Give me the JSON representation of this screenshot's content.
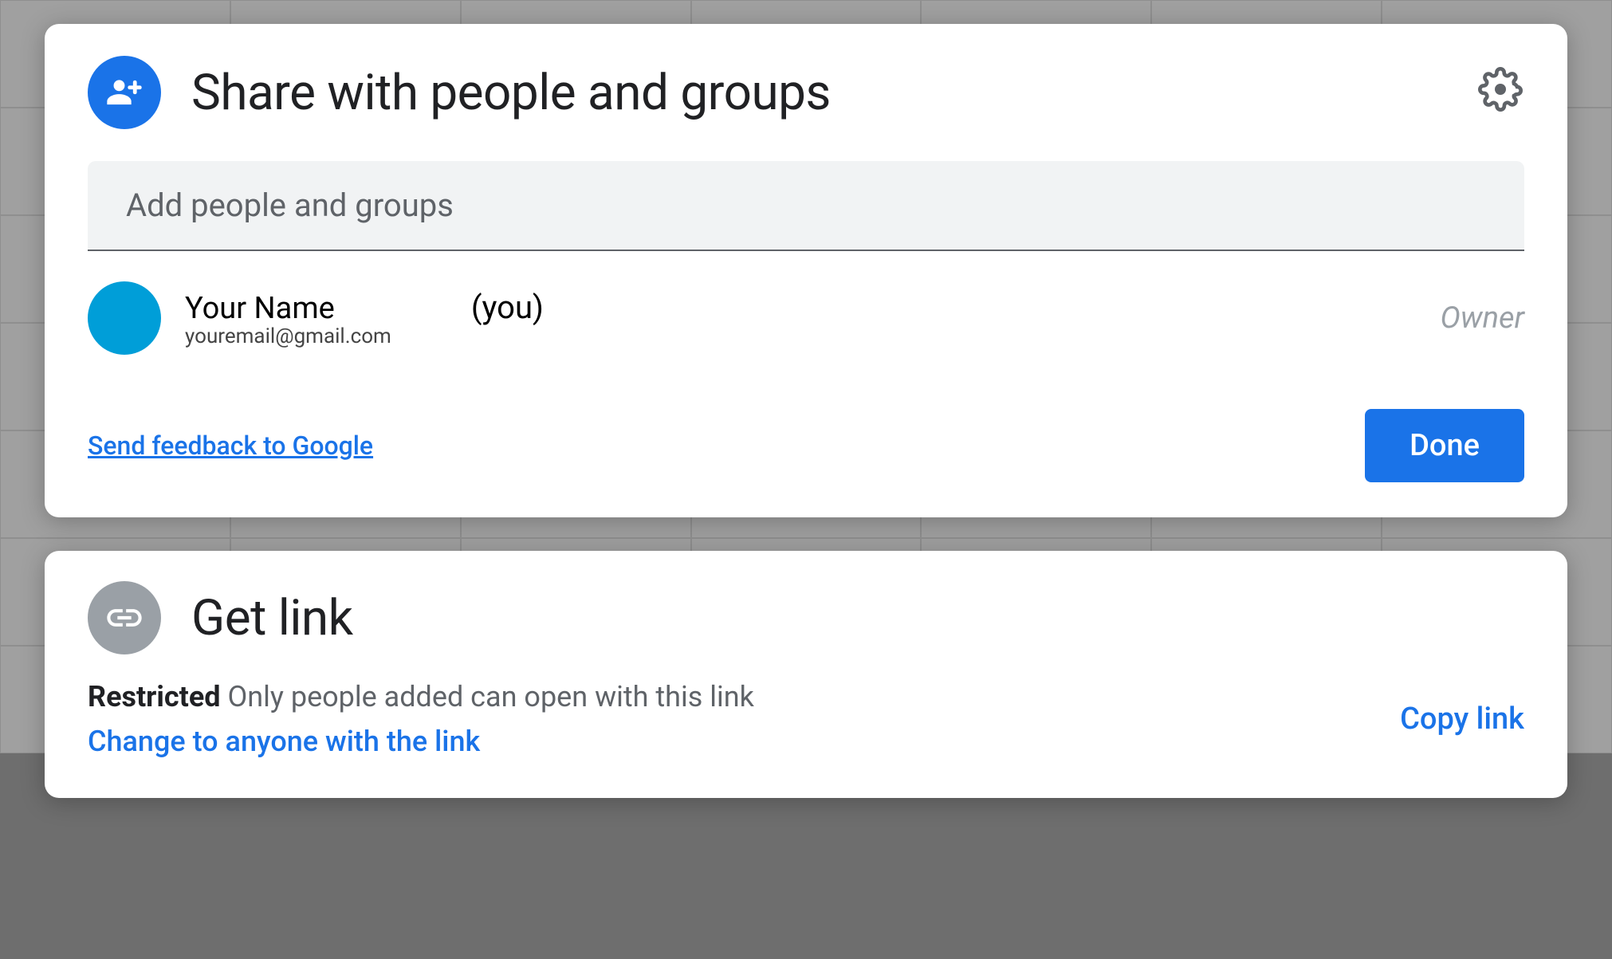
{
  "shareDialog": {
    "title": "Share with people and groups",
    "inputPlaceholder": "Add people and groups",
    "user": {
      "name": "Your Name",
      "email": "youremail@gmail.com",
      "youLabel": "(you)",
      "role": "Owner"
    },
    "feedbackLink": "Send feedback to Google",
    "doneButton": "Done"
  },
  "linkDialog": {
    "title": "Get link",
    "restrictedLabel": "Restricted",
    "restrictedDescription": "Only people added can open with this link",
    "changeLink": "Change to anyone with the link",
    "copyLink": "Copy link"
  }
}
